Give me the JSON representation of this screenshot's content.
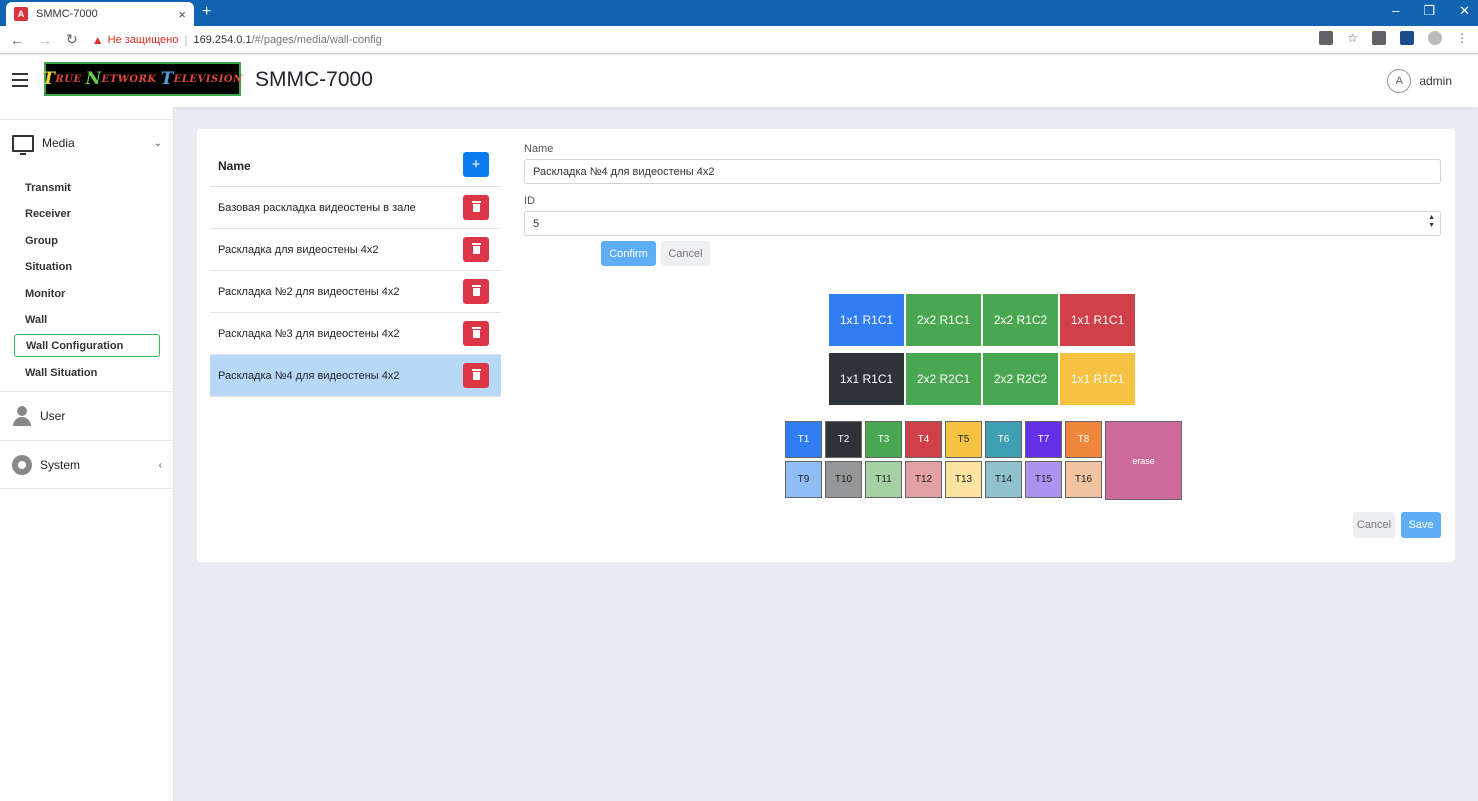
{
  "browser": {
    "tab_title": "SMMC-7000",
    "tab_favicon": "A",
    "insecure_label": "Не защищено",
    "url_host": "169.254.0.1",
    "url_path": "/#/pages/media/wall-config"
  },
  "header": {
    "app_title": "SMMC-7000",
    "user_initial": "A",
    "username": "admin",
    "logo": {
      "w1c": "T",
      "w1": "RUE",
      "w2c": "N",
      "w2": "ETWORK",
      "w3c": "T",
      "w3": "ELEVISION"
    }
  },
  "sidebar": {
    "media_label": "Media",
    "items": [
      {
        "label": "Transmit"
      },
      {
        "label": "Receiver"
      },
      {
        "label": "Group"
      },
      {
        "label": "Situation"
      },
      {
        "label": "Monitor"
      },
      {
        "label": "Wall"
      },
      {
        "label": "Wall Configuration",
        "active": true
      },
      {
        "label": "Wall Situation"
      }
    ],
    "user_label": "User",
    "system_label": "System"
  },
  "list": {
    "header": "Name",
    "add_label": "+",
    "rows": [
      {
        "name": "Базовая раскладка видеостены в зале"
      },
      {
        "name": "Раскладка для видеостены 4x2"
      },
      {
        "name": "Раскладка №2 для видеостены 4x2"
      },
      {
        "name": "Раскладка №3 для видеостены 4x2"
      },
      {
        "name": "Раскладка №4 для видеостены 4x2",
        "selected": true
      }
    ]
  },
  "form": {
    "name_label": "Name",
    "name_value": "Раскладка №4 для видеостены 4x2",
    "id_label": "ID",
    "id_value": "5",
    "confirm_label": "Confirm",
    "cancel_label": "Cancel"
  },
  "wall_grid": [
    [
      {
        "label": "1x1 R1C1",
        "color": "#2f7cf3"
      },
      {
        "label": "2x2 R1C1",
        "color": "#4aa751"
      },
      {
        "label": "2x2 R1C2",
        "color": "#4aa751"
      },
      {
        "label": "1x1 R1C1",
        "color": "#d04048"
      }
    ],
    [
      {
        "label": "1x1 R1C1",
        "color": "#2d3339"
      },
      {
        "label": "2x2 R2C1",
        "color": "#4aa751"
      },
      {
        "label": "2x2 R2C2",
        "color": "#4aa751"
      },
      {
        "label": "1x1 R1C1",
        "color": "#f5c242"
      }
    ]
  ],
  "palette": [
    {
      "label": "T1",
      "color": "#2f7cf3"
    },
    {
      "label": "T2",
      "color": "#2d3339"
    },
    {
      "label": "T3",
      "color": "#4aa751"
    },
    {
      "label": "T4",
      "color": "#d04048"
    },
    {
      "label": "T5",
      "color": "#f5c242"
    },
    {
      "label": "T6",
      "color": "#3f9fb3"
    },
    {
      "label": "T7",
      "color": "#6231e8"
    },
    {
      "label": "T8",
      "color": "#ee8739"
    },
    {
      "label": "T9",
      "color": "#8fbdf6"
    },
    {
      "label": "T10",
      "color": "#949697"
    },
    {
      "label": "T11",
      "color": "#a5d2a5"
    },
    {
      "label": "T12",
      "color": "#e4a1a5"
    },
    {
      "label": "T13",
      "color": "#fbe3a2"
    },
    {
      "label": "T14",
      "color": "#8fc2cd"
    },
    {
      "label": "T15",
      "color": "#ad93ef"
    },
    {
      "label": "T16",
      "color": "#f0c3a1"
    }
  ],
  "erase_label": "erase",
  "actions": {
    "cancel_label": "Cancel",
    "save_label": "Save"
  }
}
